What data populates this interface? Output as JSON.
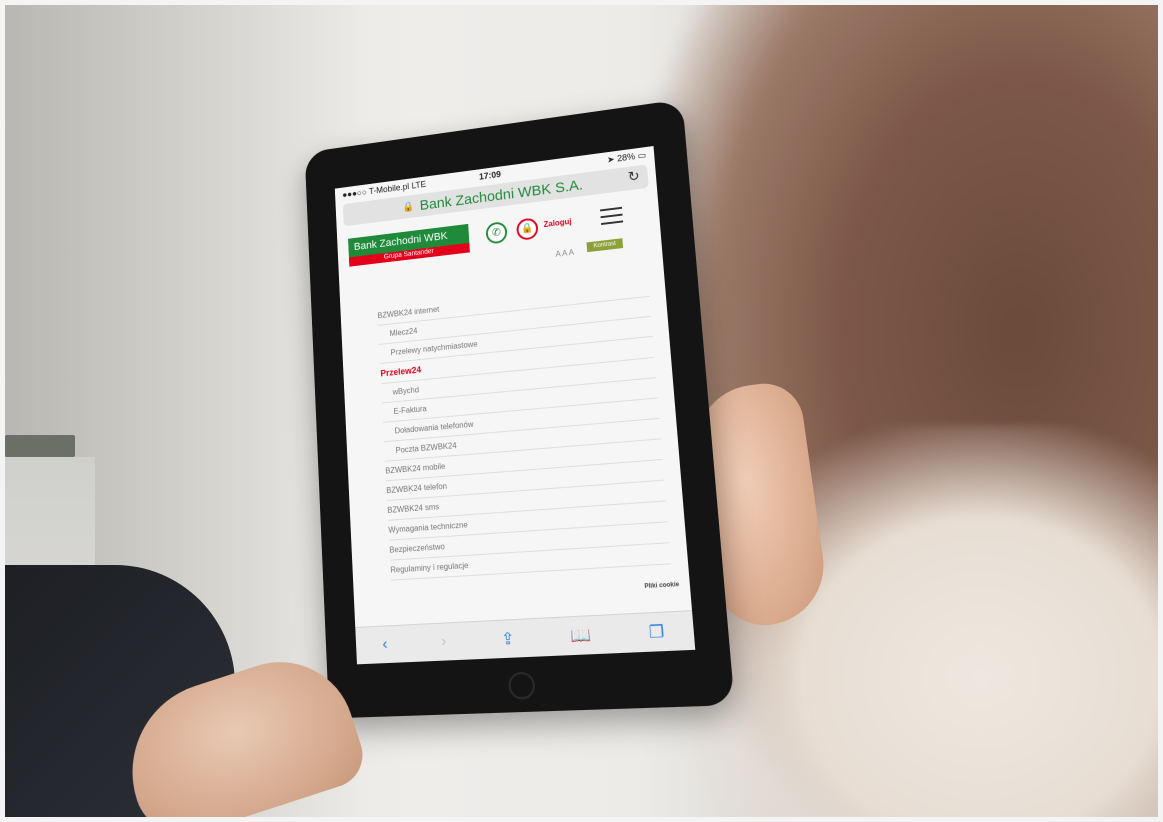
{
  "statusbar": {
    "carrier": "T-Mobile.pl",
    "network": "LTE",
    "time": "17:09",
    "battery": "28%"
  },
  "address": {
    "site": "Bank Zachodni WBK S.A."
  },
  "header": {
    "logo_top": "Bank Zachodni WBK",
    "logo_bottom": "Grupa Santander",
    "login": "Zaloguj",
    "font_size": "A A A",
    "contrast": "Kontrast"
  },
  "menu": {
    "items": [
      {
        "label": "BZWBK24 internet",
        "level": 1
      },
      {
        "label": "Mlecz24",
        "level": 2
      },
      {
        "label": "Przelewy natychmiastowe",
        "level": 2
      },
      {
        "label": "Przelew24",
        "level": 1,
        "active": true
      },
      {
        "label": "wBychd",
        "level": 2
      },
      {
        "label": "E-Faktura",
        "level": 2
      },
      {
        "label": "Doładowania telefonów",
        "level": 2
      },
      {
        "label": "Poczta BZWBK24",
        "level": 2
      },
      {
        "label": "BZWBK24 mobile",
        "level": 1
      },
      {
        "label": "BZWBK24 telefon",
        "level": 1
      },
      {
        "label": "BZWBK24 sms",
        "level": 1
      },
      {
        "label": "Wymagania techniczne",
        "level": 1
      },
      {
        "label": "Bezpieczeństwo",
        "level": 1
      },
      {
        "label": "Regulaminy i regulacje",
        "level": 1
      }
    ]
  },
  "footer": {
    "cookie": "Pliki cookie"
  },
  "toolbar": {
    "back_icon": "chevron-left-icon",
    "forward_icon": "chevron-right-icon",
    "share_icon": "share-icon",
    "bookmarks_icon": "book-icon",
    "tabs_icon": "tabs-icon"
  },
  "colors": {
    "brand_green": "#1f8a3a",
    "brand_red": "#e3001b",
    "ios_blue": "#2f7de1"
  }
}
